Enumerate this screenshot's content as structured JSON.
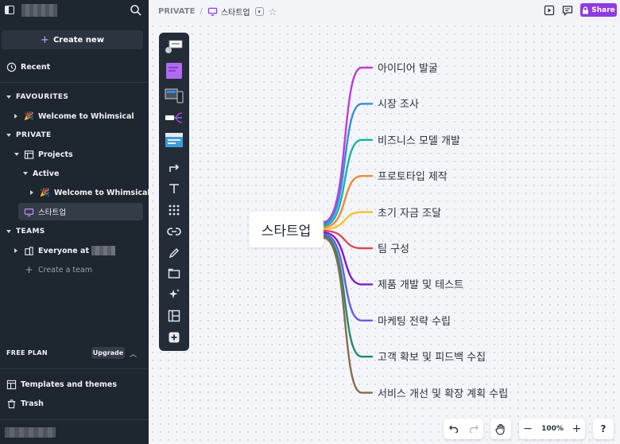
{
  "sidebar": {
    "create_new": "Create new",
    "recent": "Recent",
    "favourites": "FAVOURITES",
    "fav_item": "Welcome to Whimsical",
    "private": "PRIVATE",
    "projects": "Projects",
    "active": "Active",
    "active_item": "Welcome to Whimsical",
    "doc_item": "스타트업",
    "teams": "TEAMS",
    "everyone": "Everyone at",
    "create_team": "Create a team",
    "free_plan": "FREE PLAN",
    "upgrade": "Upgrade",
    "templates": "Templates and themes",
    "trash": "Trash"
  },
  "topbar": {
    "section": "PRIVATE",
    "separator": "/",
    "doc_title": "스타트업",
    "share": "Share"
  },
  "mindmap": {
    "center": "스타트업",
    "branches": [
      {
        "label": "아이디어 발굴",
        "color": "#c03bd9"
      },
      {
        "label": "시장 조사",
        "color": "#2f8fe0"
      },
      {
        "label": "비즈니스 모델 개발",
        "color": "#17b3a9"
      },
      {
        "label": "프로토타입 제작",
        "color": "#ee8a3a"
      },
      {
        "label": "초기 자금 조달",
        "color": "#f2c230"
      },
      {
        "label": "팀 구성",
        "color": "#d64a5a"
      },
      {
        "label": "제품 개발 및 테스트",
        "color": "#7a1fc9"
      },
      {
        "label": "마케팅 전략 수립",
        "color": "#6a5ae6"
      },
      {
        "label": "고객 확보 및 피드백 수집",
        "color": "#1f8b74"
      },
      {
        "label": "서비스 개선 및 확장 계획 수립",
        "color": "#8a6a4a"
      }
    ]
  },
  "controls": {
    "zoom": "100%",
    "help": "?"
  },
  "colors": {
    "sidebar_bg": "#1e2630",
    "accent": "#8f3bdf"
  }
}
